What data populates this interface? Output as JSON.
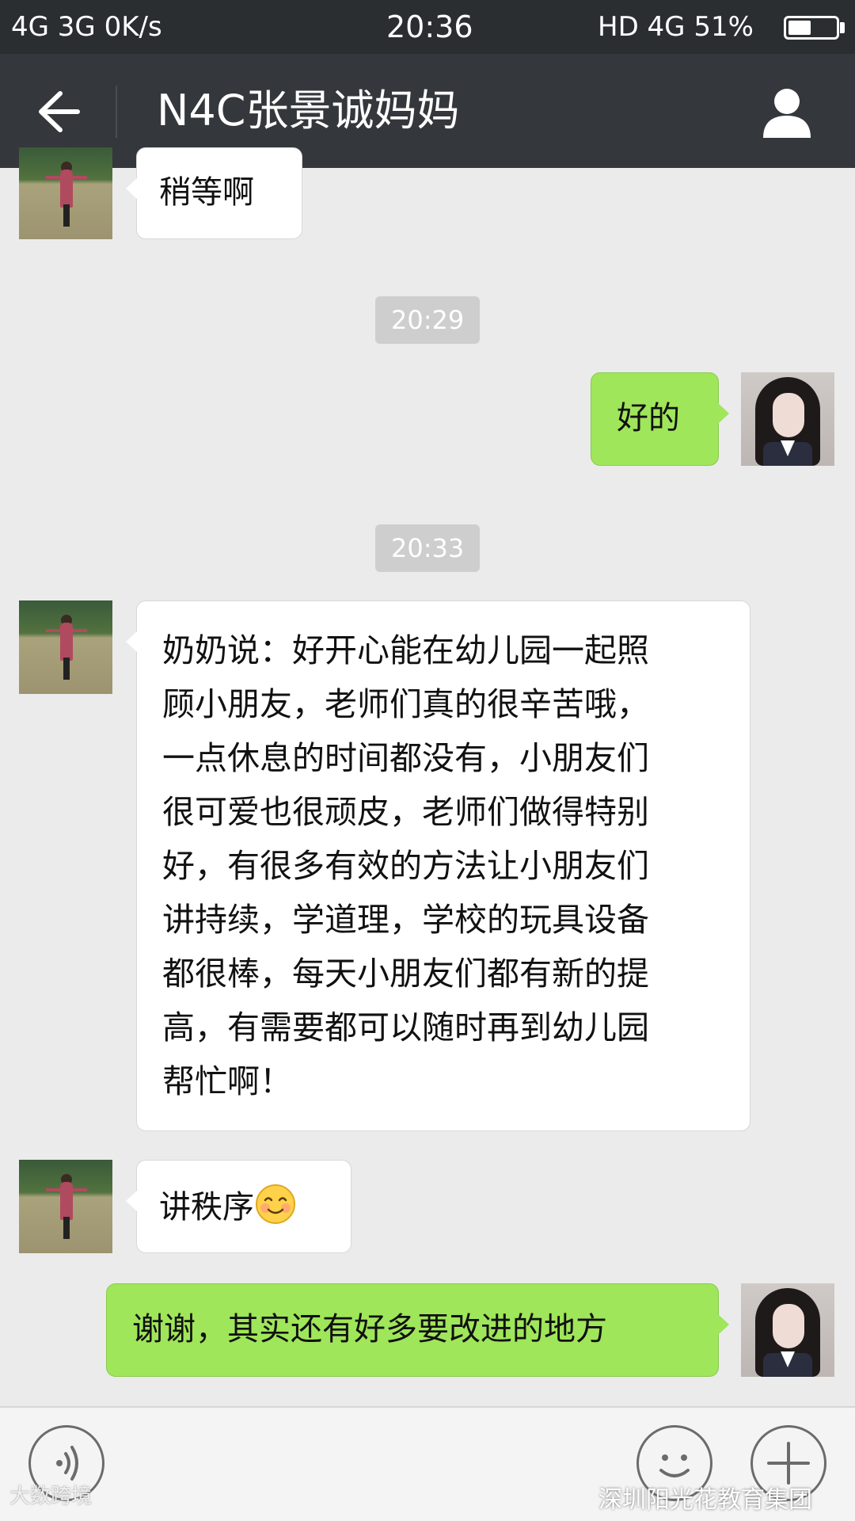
{
  "status_bar": {
    "left": "4G 3G 0K/s",
    "time": "20:36",
    "right": "HD 4G 51%"
  },
  "nav": {
    "title": "N4C张景诚妈妈"
  },
  "messages": [
    {
      "side": "in",
      "text": "稍等啊"
    },
    {
      "type": "timestamp",
      "text": "20:29"
    },
    {
      "side": "out",
      "text": "好的"
    },
    {
      "type": "timestamp",
      "text": "20:33"
    },
    {
      "side": "in",
      "lines": [
        "奶奶说：好开心能在幼儿园一起照",
        "顾小朋友，老师们真的很辛苦哦，",
        "一点休息的时间都没有，小朋友们",
        "很可爱也很顽皮，老师们做得特别",
        "好，有很多有效的方法让小朋友们",
        "讲持续，学道理，学校的玩具设备",
        "都很棒，每天小朋友们都有新的提",
        "高，有需要都可以随时再到幼儿园",
        "帮忙啊！"
      ]
    },
    {
      "side": "in",
      "text": "讲秩序",
      "emoji": "smile-emoji"
    },
    {
      "side": "out",
      "text": "谢谢，其实还有好多要改进的地方"
    }
  ],
  "watermarks": {
    "left": "大数跨境",
    "right": "深圳阳光花教育集团"
  },
  "colors": {
    "outgoing_bubble": "#9fe65a",
    "incoming_bubble": "#ffffff",
    "nav_bar": "#34373b",
    "background": "#ebebeb"
  },
  "icons": {
    "back": "back-arrow-icon",
    "profile": "person-icon",
    "voice": "voice-icon",
    "emoji": "emoji-icon",
    "plus": "plus-icon"
  }
}
